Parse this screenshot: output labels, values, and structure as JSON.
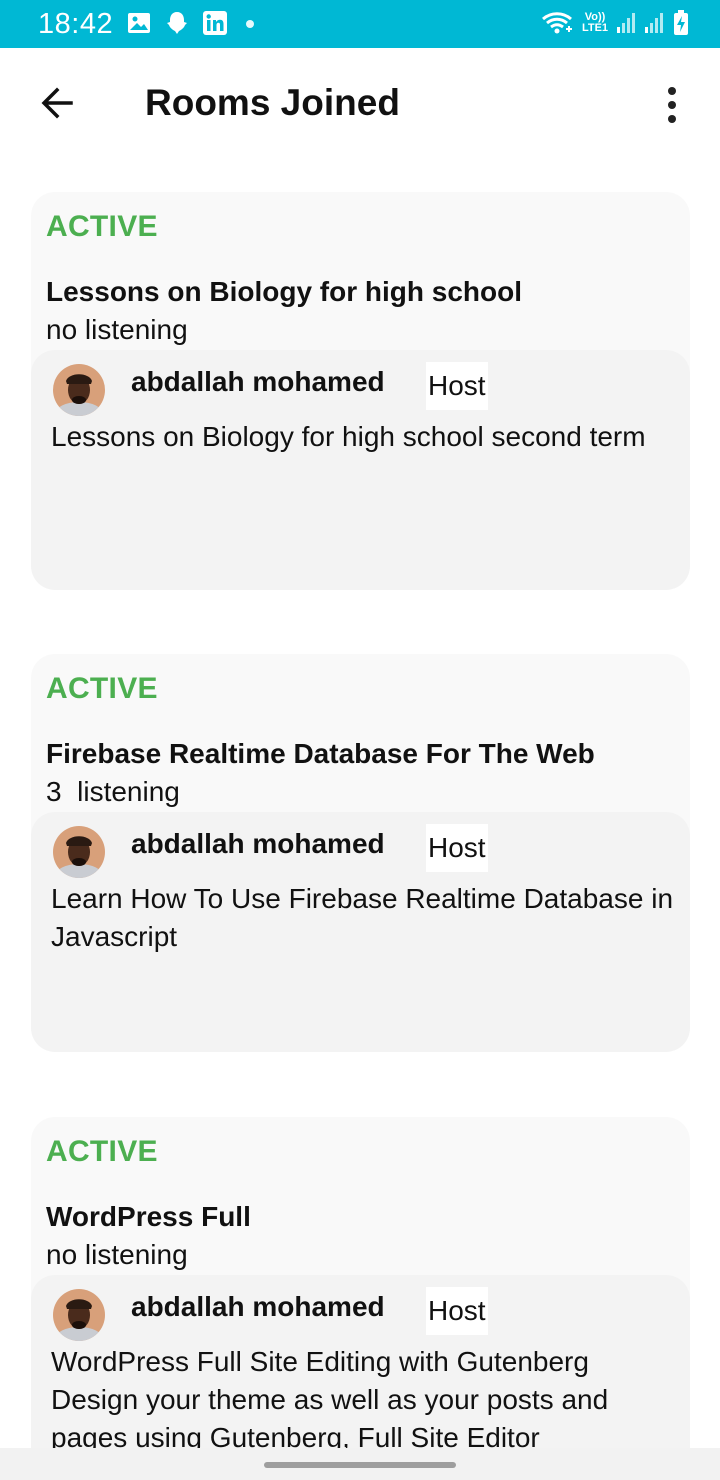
{
  "status_bar": {
    "time": "18:42",
    "left_icons": [
      "gallery-icon",
      "snapchat-icon",
      "linkedin-icon",
      "notification-dot-icon"
    ],
    "right_icons": [
      "wifi-icon",
      "volte-lte-icon",
      "signal-icon",
      "signal-icon",
      "battery-charging-icon"
    ],
    "volte_label": "Vo))",
    "lte_label": "LTE1",
    "background": "#00b8d4"
  },
  "app_bar": {
    "title": "Rooms Joined",
    "back_icon": "arrow-left-icon",
    "menu_icon": "more-vertical-icon"
  },
  "rooms": [
    {
      "status": "ACTIVE",
      "title": "Lessons on Biology for high school",
      "listening": "no listening",
      "host_name": "abdallah mohamed",
      "host_badge": "Host",
      "description": "Lessons on Biology for high school second term"
    },
    {
      "status": "ACTIVE",
      "title": "Firebase Realtime Database For The Web",
      "listening": "3  listening",
      "host_name": "abdallah mohamed",
      "host_badge": "Host",
      "description": "Learn How To Use Firebase Realtime Database in Javascript"
    },
    {
      "status": "ACTIVE",
      "title": "WordPress Full",
      "listening": "no listening",
      "host_name": "abdallah mohamed",
      "host_badge": "Host",
      "description": "WordPress Full Site Editing with Gutenberg Design your theme as well as your posts and pages using Gutenberg, Full Site Editor"
    }
  ],
  "colors": {
    "accent": "#00b8d4",
    "active_status": "#4caf50",
    "card_background": "#f9f9f9",
    "inner_card_background": "#f3f3f3"
  }
}
